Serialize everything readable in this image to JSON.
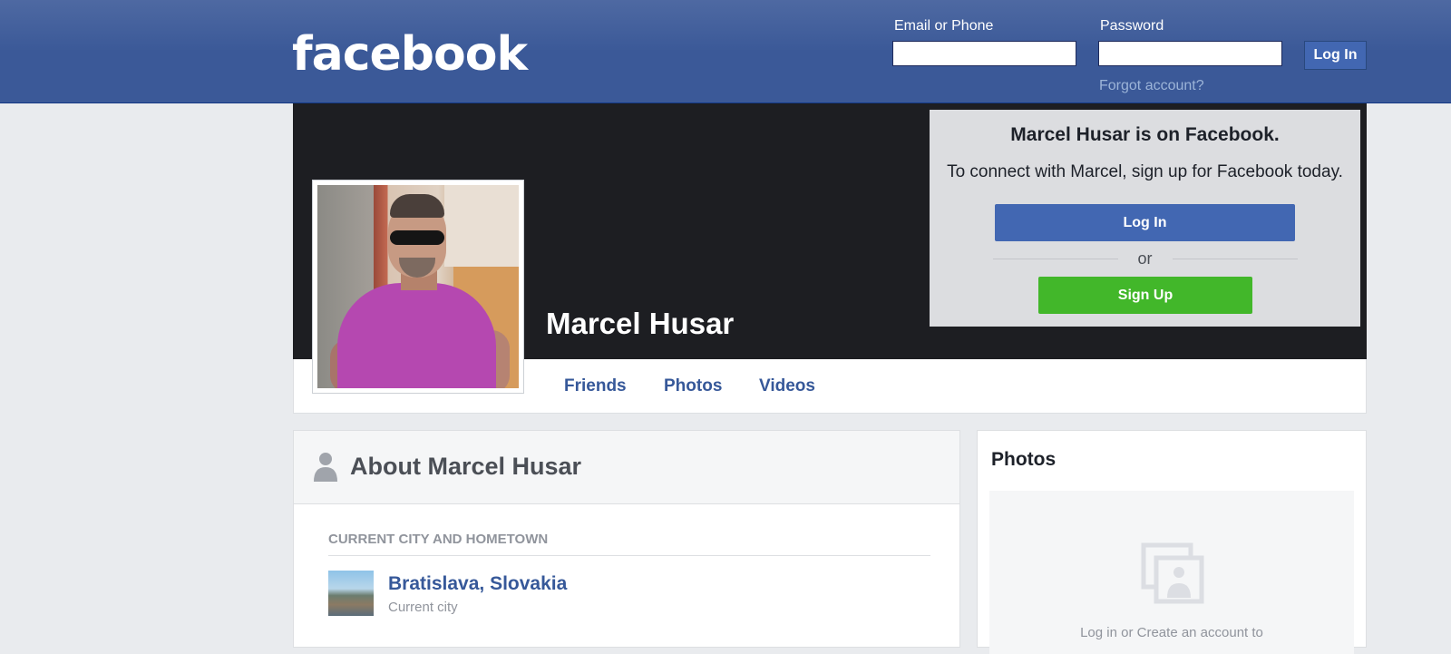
{
  "header": {
    "logo_text": "facebook",
    "email_label": "Email or Phone",
    "email_value": "",
    "password_label": "Password",
    "password_value": "",
    "login_button": "Log In",
    "forgot_link": "Forgot account?"
  },
  "profile": {
    "name": "Marcel Husar"
  },
  "signup_box": {
    "title": "Marcel Husar is on Facebook.",
    "text": "To connect with Marcel, sign up for Facebook today.",
    "login_button": "Log In",
    "or_text": "or",
    "signup_button": "Sign Up"
  },
  "tabs": [
    {
      "label": "Friends"
    },
    {
      "label": "Photos"
    },
    {
      "label": "Videos"
    }
  ],
  "about": {
    "title": "About Marcel Husar",
    "section_label": "CURRENT CITY AND HOMETOWN",
    "city": "Bratislava, Slovakia",
    "city_sub": "Current city"
  },
  "photos": {
    "title": "Photos",
    "prompt": "Log in or Create an account to"
  },
  "colors": {
    "brand_blue": "#3b5998",
    "link_blue": "#365899",
    "button_blue": "#4267b2",
    "signup_green": "#42b72a"
  }
}
